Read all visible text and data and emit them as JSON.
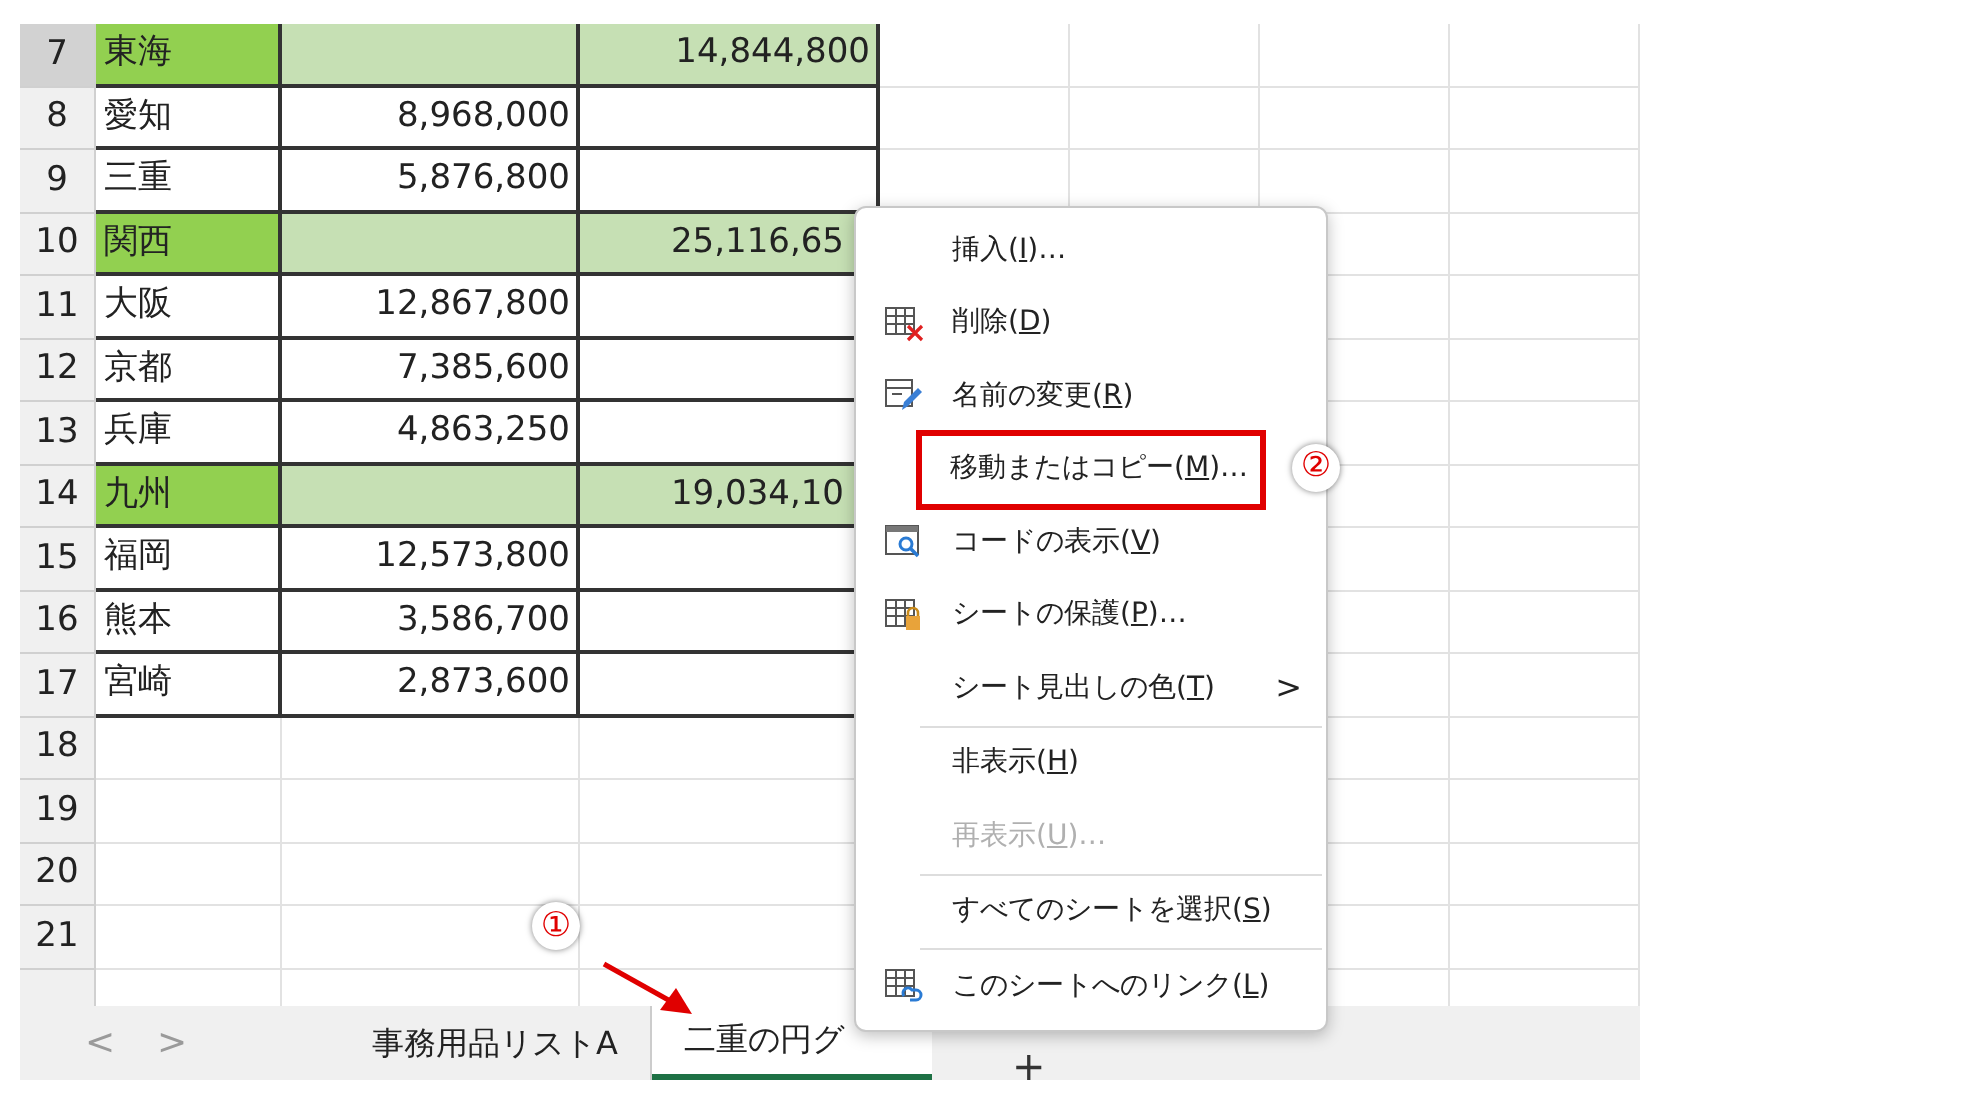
{
  "sheet": {
    "rows": [
      {
        "number": "7",
        "kind": "region",
        "selected": true,
        "name": "東海",
        "total": "14,844,800",
        "truncated": false
      },
      {
        "number": "8",
        "kind": "detail",
        "selected": false,
        "name": "愛知",
        "amount": "8,968,000"
      },
      {
        "number": "9",
        "kind": "detail",
        "selected": false,
        "name": "三重",
        "amount": "5,876,800"
      },
      {
        "number": "10",
        "kind": "region",
        "selected": false,
        "name": "関西",
        "total": "25,116,65",
        "truncated": true
      },
      {
        "number": "11",
        "kind": "detail",
        "selected": false,
        "name": "大阪",
        "amount": "12,867,800"
      },
      {
        "number": "12",
        "kind": "detail",
        "selected": false,
        "name": "京都",
        "amount": "7,385,600"
      },
      {
        "number": "13",
        "kind": "detail",
        "selected": false,
        "name": "兵庫",
        "amount": "4,863,250"
      },
      {
        "number": "14",
        "kind": "region",
        "selected": false,
        "name": "九州",
        "total": "19,034,10",
        "truncated": true
      },
      {
        "number": "15",
        "kind": "detail",
        "selected": false,
        "name": "福岡",
        "amount": "12,573,800"
      },
      {
        "number": "16",
        "kind": "detail",
        "selected": false,
        "name": "熊本",
        "amount": "3,586,700"
      },
      {
        "number": "17",
        "kind": "detail",
        "selected": false,
        "name": "宮崎",
        "amount": "2,873,600"
      },
      {
        "number": "18",
        "kind": "empty",
        "selected": false
      },
      {
        "number": "19",
        "kind": "empty",
        "selected": false
      },
      {
        "number": "20",
        "kind": "empty",
        "selected": false
      },
      {
        "number": "21",
        "kind": "empty",
        "selected": false
      },
      {
        "kind": "cut",
        "selected": false
      }
    ]
  },
  "sheet_tabs": {
    "prev": "<",
    "next": ">",
    "add": "+",
    "tabs": [
      {
        "label": "事務用品リストA",
        "selected": false
      },
      {
        "label": "二重の円グ",
        "selected": true,
        "step": "①"
      }
    ]
  },
  "context_menu": {
    "items": [
      {
        "kind": "item",
        "before": "挿入(",
        "key": "I",
        "after": ")…",
        "disabled": false,
        "highlighted": false
      },
      {
        "kind": "item",
        "before": "削除(",
        "key": "D",
        "after": ")",
        "disabled": false,
        "highlighted": false
      },
      {
        "kind": "item",
        "before": "名前の変更(",
        "key": "R",
        "after": ")",
        "disabled": false,
        "highlighted": false
      },
      {
        "kind": "item",
        "before": "移動またはコピー(",
        "key": "M",
        "after": ")…",
        "disabled": false,
        "highlighted": true,
        "step": "②"
      },
      {
        "kind": "item",
        "before": "コードの表示(",
        "key": "V",
        "after": ")",
        "disabled": false,
        "highlighted": false
      },
      {
        "kind": "item",
        "before": "シートの保護(",
        "key": "P",
        "after": ")…",
        "disabled": false,
        "highlighted": false
      },
      {
        "kind": "submenu",
        "before": "シート見出しの色(",
        "key": "T",
        "after": ")",
        "submenu_mark": ">",
        "disabled": false,
        "highlighted": false
      },
      {
        "kind": "separator"
      },
      {
        "kind": "item",
        "before": "非表示(",
        "key": "H",
        "after": ")",
        "disabled": false,
        "highlighted": false
      },
      {
        "kind": "item",
        "before": "再表示(",
        "key": "U",
        "after": ")…",
        "disabled": true,
        "highlighted": false
      },
      {
        "kind": "separator"
      },
      {
        "kind": "item",
        "before": "すべてのシートを選択(",
        "key": "S",
        "after": ")",
        "disabled": false,
        "highlighted": false
      },
      {
        "kind": "separator"
      },
      {
        "kind": "item",
        "before": "このシートへのリンク(",
        "key": "L",
        "after": ")",
        "disabled": false,
        "highlighted": false
      }
    ]
  }
}
